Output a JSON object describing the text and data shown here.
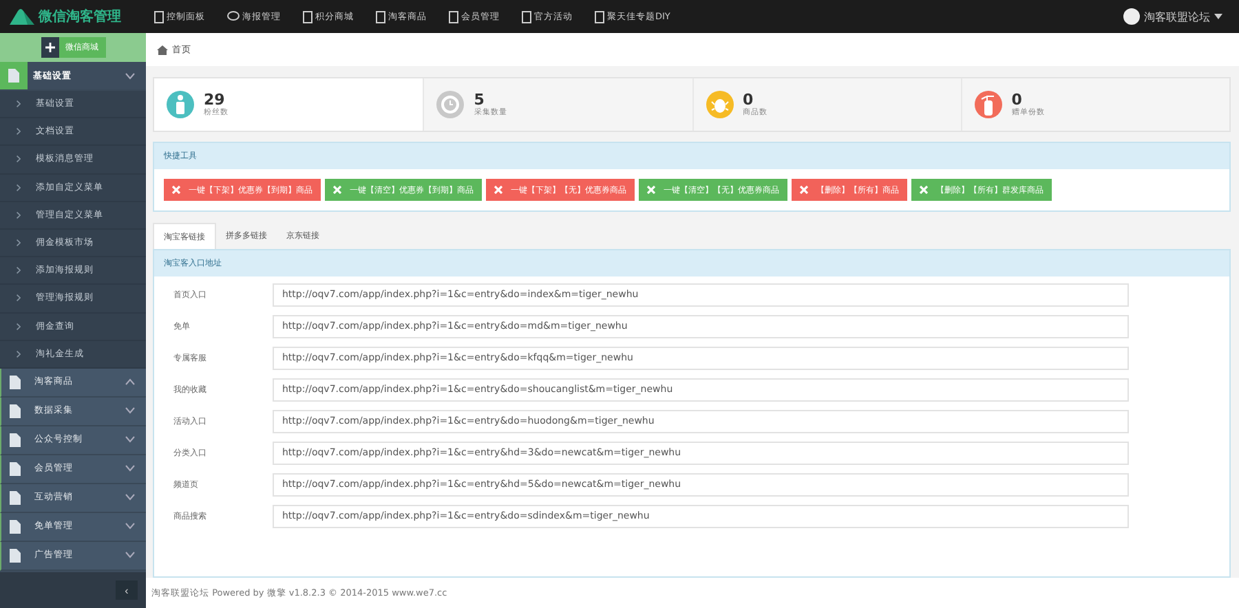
{
  "brand": "微信淘客管理",
  "top_nav": [
    {
      "label": "控制面板"
    },
    {
      "label": "海报管理"
    },
    {
      "label": "积分商城"
    },
    {
      "label": "淘客商品"
    },
    {
      "label": "会员管理"
    },
    {
      "label": "官方活动"
    },
    {
      "label": "聚天佳专题DIY"
    }
  ],
  "user": {
    "name": "淘客联盟论坛"
  },
  "sidebar": {
    "add_button": "微信商城",
    "groups": [
      {
        "label": "基础设置",
        "expanded": true,
        "selected": true,
        "children": [
          {
            "label": "基础设置"
          },
          {
            "label": "文档设置"
          },
          {
            "label": "模板消息管理"
          },
          {
            "label": "添加自定义菜单"
          },
          {
            "label": "管理自定义菜单"
          },
          {
            "label": "佣金模板市场"
          },
          {
            "label": "添加海报规则"
          },
          {
            "label": "管理海报规则"
          },
          {
            "label": "佣金查询"
          },
          {
            "label": "淘礼金生成"
          }
        ]
      },
      {
        "label": "淘客商品",
        "expanded": true,
        "selected": false
      },
      {
        "label": "数据采集",
        "expanded": false,
        "selected": false
      },
      {
        "label": "公众号控制",
        "expanded": false,
        "selected": false
      },
      {
        "label": "会员管理",
        "expanded": false,
        "selected": false
      },
      {
        "label": "互动营销",
        "expanded": false,
        "selected": false
      },
      {
        "label": "免单管理",
        "expanded": false,
        "selected": false
      },
      {
        "label": "广告管理",
        "expanded": false,
        "selected": false
      }
    ],
    "collapse": "‹"
  },
  "breadcrumb": "首页",
  "stats": [
    {
      "value": "29",
      "label": "粉丝数",
      "color": "#4cbfc0"
    },
    {
      "value": "5",
      "label": "采集数量",
      "color": "#c8c8c8"
    },
    {
      "value": "0",
      "label": "商品数",
      "color": "#f6bb25"
    },
    {
      "value": "0",
      "label": "赠单份数",
      "color": "#f26c5a"
    }
  ],
  "quick_tools": {
    "title": "快捷工具",
    "buttons": [
      {
        "label": "一键【下架】优惠券【到期】商品",
        "kind": "danger"
      },
      {
        "label": "一键【清空】优惠券【到期】商品",
        "kind": "success"
      },
      {
        "label": "一键【下架】【无】优惠券商品",
        "kind": "danger"
      },
      {
        "label": "一键【清空】【无】优惠券商品",
        "kind": "success"
      },
      {
        "label": "【删除】【所有】商品",
        "kind": "danger"
      },
      {
        "label": "【删除】【所有】群发库商品",
        "kind": "success"
      }
    ]
  },
  "tabs": [
    {
      "label": "淘宝客链接",
      "selected": true
    },
    {
      "label": "拼多多链接",
      "selected": false
    },
    {
      "label": "京东链接",
      "selected": false
    }
  ],
  "links_panel": {
    "title": "淘宝客入口地址",
    "rows": [
      {
        "label": "首页入口",
        "value": "http://oqv7.com/app/index.php?i=1&c=entry&do=index&m=tiger_newhu"
      },
      {
        "label": "免单",
        "value": "http://oqv7.com/app/index.php?i=1&c=entry&do=md&m=tiger_newhu"
      },
      {
        "label": "专属客服",
        "value": "http://oqv7.com/app/index.php?i=1&c=entry&do=kfqq&m=tiger_newhu"
      },
      {
        "label": "我的收藏",
        "value": "http://oqv7.com/app/index.php?i=1&c=entry&do=shoucanglist&m=tiger_newhu"
      },
      {
        "label": "活动入口",
        "value": "http://oqv7.com/app/index.php?i=1&c=entry&do=huodong&m=tiger_newhu"
      },
      {
        "label": "分类入口",
        "value": "http://oqv7.com/app/index.php?i=1&c=entry&hd=3&do=newcat&m=tiger_newhu"
      },
      {
        "label": "频道页",
        "value": "http://oqv7.com/app/index.php?i=1&c=entry&hd=5&do=newcat&m=tiger_newhu"
      },
      {
        "label": "商品搜索",
        "value": "http://oqv7.com/app/index.php?i=1&c=entry&do=sdindex&m=tiger_newhu"
      }
    ]
  },
  "footer": "淘客联盟论坛 Powered by 微擎 v1.8.2.3 © 2014-2015 www.we7.cc"
}
